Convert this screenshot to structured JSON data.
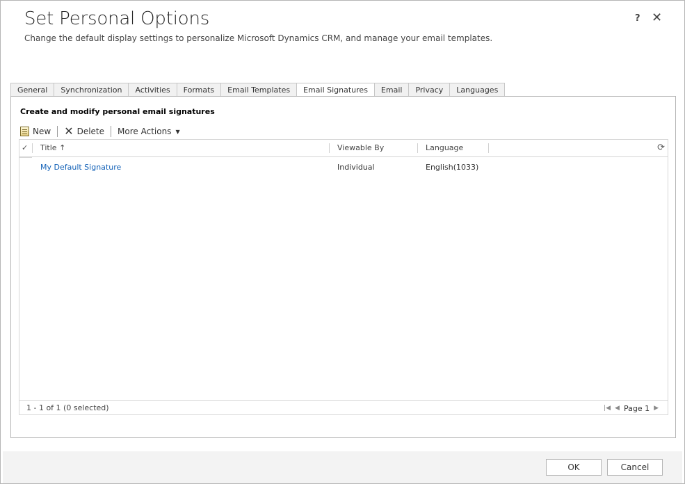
{
  "dialog": {
    "title": "Set Personal Options",
    "subtitle": "Change the default display settings to personalize Microsoft Dynamics CRM, and manage your email templates.",
    "help_label": "?",
    "close_label": "✕"
  },
  "tabs": [
    {
      "label": "General",
      "active": false
    },
    {
      "label": "Synchronization",
      "active": false
    },
    {
      "label": "Activities",
      "active": false
    },
    {
      "label": "Formats",
      "active": false
    },
    {
      "label": "Email Templates",
      "active": false
    },
    {
      "label": "Email Signatures",
      "active": true
    },
    {
      "label": "Email",
      "active": false
    },
    {
      "label": "Privacy",
      "active": false
    },
    {
      "label": "Languages",
      "active": false
    }
  ],
  "panel": {
    "heading": "Create and modify personal email signatures"
  },
  "commands": {
    "new_label": "New",
    "delete_label": "Delete",
    "more_actions_label": "More Actions"
  },
  "grid": {
    "columns": {
      "title": "Title ↑",
      "viewable_by": "Viewable By",
      "language": "Language"
    },
    "rows": [
      {
        "title": "My Default Signature",
        "viewable_by": "Individual",
        "language": "English(1033)"
      }
    ],
    "record_count": "1 - 1 of 1 (0 selected)",
    "page_label": "Page 1"
  },
  "footer": {
    "ok_label": "OK",
    "cancel_label": "Cancel"
  }
}
